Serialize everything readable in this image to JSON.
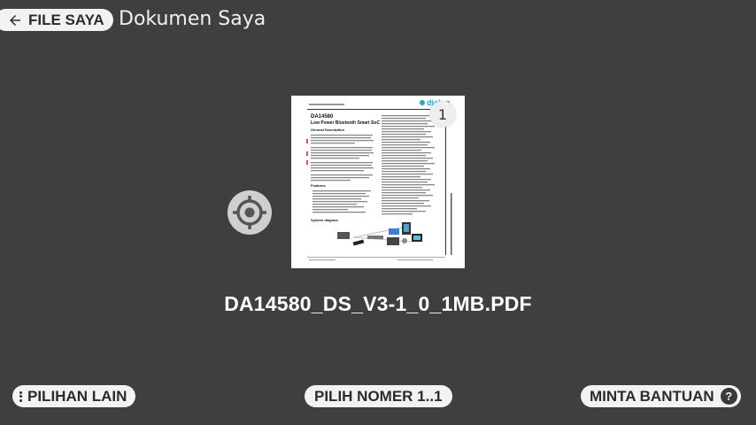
{
  "header": {
    "back_label": "FILE SAYA",
    "title": "Dokumen Saya"
  },
  "document": {
    "filename": "DA14580_DS_V3-1_0_1MB.PDF",
    "page_badge": "1",
    "thumbnail": {
      "title_line1": "DA14580",
      "title_line2": "Low Power Bluetooth Smart SoC",
      "section1": "General Description",
      "section2": "Features",
      "section3": "System diagram",
      "logo_text": "dialog"
    }
  },
  "footer": {
    "more_label": "PILIHAN LAIN",
    "select_label": "PILIH NOMER 1..1",
    "help_label": "MINTA BANTUAN",
    "help_icon": "?"
  },
  "colors": {
    "background": "#3f3f3f",
    "pill": "#f2f2f2",
    "pill_text": "#2b2b2b",
    "target_button": "#cfcfcf"
  },
  "icons": {
    "back": "arrow-left-icon",
    "locate": "crosshair-icon",
    "more": "vertical-dots-icon",
    "help": "question-circle-icon"
  }
}
